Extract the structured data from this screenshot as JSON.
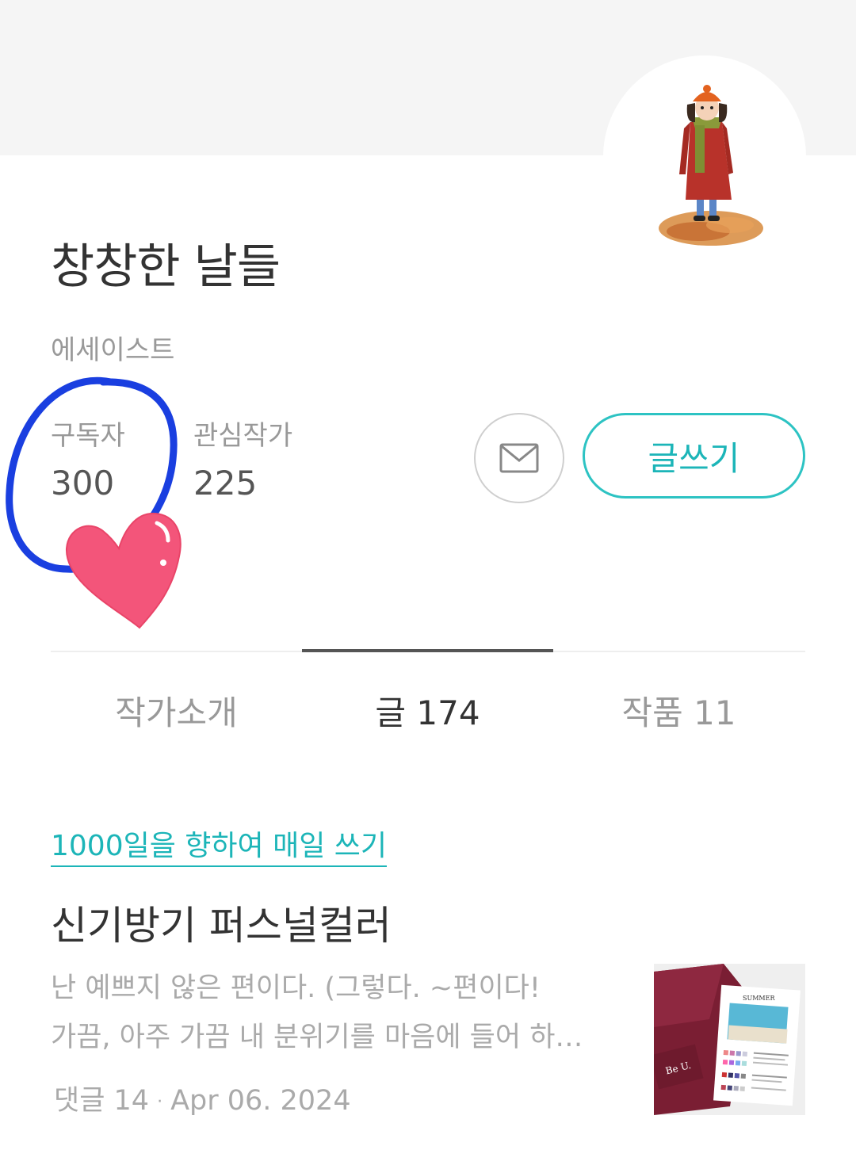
{
  "profile": {
    "name": "창창한 날들",
    "role": "에세이스트",
    "avatar_icon": "illustrated-girl-avatar",
    "stats": {
      "subscribers_label": "구독자",
      "subscribers_value": "300",
      "following_label": "관심작가",
      "following_value": "225"
    },
    "actions": {
      "message_icon": "envelope-icon",
      "write_label": "글쓰기"
    }
  },
  "tabs": [
    {
      "label": "작가소개",
      "active": false
    },
    {
      "label": "글 174",
      "active": true
    },
    {
      "label": "작품 11",
      "active": false
    }
  ],
  "post": {
    "magazine": "1000일을 향하여 매일 쓰기",
    "title": "신기방기 퍼스널컬러",
    "excerpt_line1": "난 예쁘지 않은 편이다. (그렇다. ~편이다!",
    "excerpt_line2": "가끔, 아주 가끔 내 분위기를 마음에 들어 하…",
    "comments": "댓글 14",
    "separator": "·",
    "date": "Apr 06. 2024",
    "thumbnail_text": "SUMMER"
  },
  "colors": {
    "accent": "#1cb5b8",
    "doodle_circle": "#1a3fe0",
    "heart": "#f3557a"
  }
}
